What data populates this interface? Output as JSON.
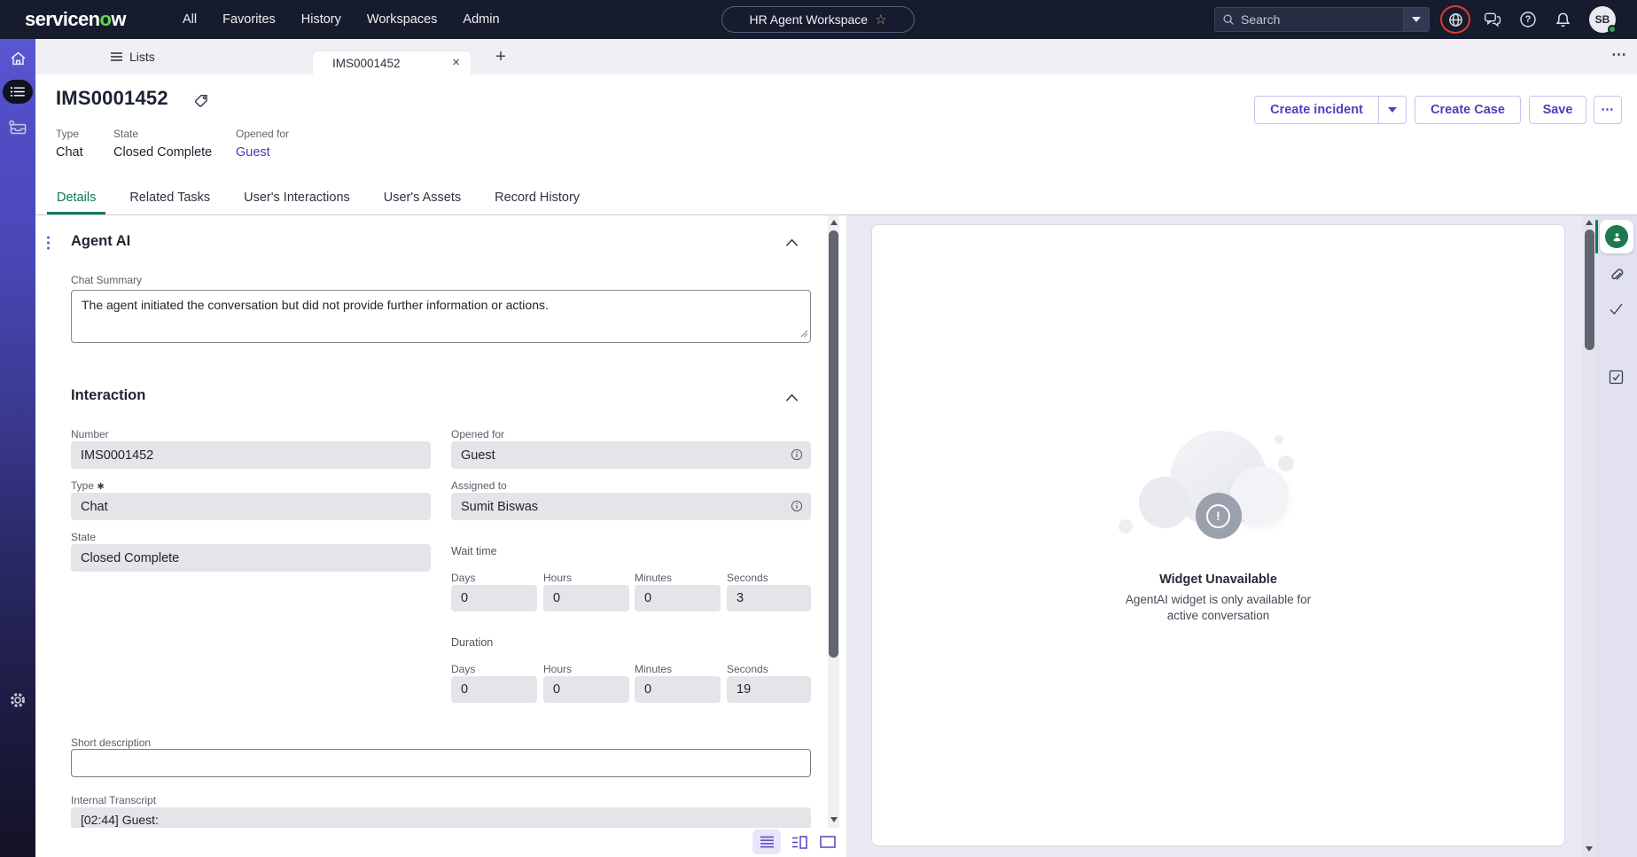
{
  "header": {
    "logo": {
      "part1": "servicen",
      "accent": "o",
      "part2": "w"
    },
    "nav": [
      "All",
      "Favorites",
      "History",
      "Workspaces",
      "Admin"
    ],
    "workspace_pill": "HR Agent Workspace",
    "search": {
      "placeholder": "Search"
    },
    "avatar": {
      "initials": "SB"
    }
  },
  "tabstrip": {
    "lists": "Lists",
    "active_tab": "IMS0001452"
  },
  "record": {
    "title": "IMS0001452",
    "meta": {
      "type_label": "Type",
      "type_value": "Chat",
      "state_label": "State",
      "state_value": "Closed Complete",
      "opened_for_label": "Opened for",
      "opened_for_value": "Guest"
    },
    "actions": {
      "create_incident": "Create incident",
      "create_case": "Create Case",
      "save": "Save"
    }
  },
  "detail_tabs": [
    "Details",
    "Related Tasks",
    "User's Interactions",
    "User's Assets",
    "Record History"
  ],
  "form": {
    "agent_ai_title": "Agent AI",
    "chat_summary": {
      "label": "Chat Summary",
      "value": "The agent initiated the conversation but did not provide further information or actions."
    },
    "interaction_title": "Interaction",
    "number": {
      "label": "Number",
      "value": "IMS0001452"
    },
    "opened_for": {
      "label": "Opened for",
      "value": "Guest"
    },
    "type": {
      "label": "Type",
      "value": "Chat"
    },
    "assigned_to": {
      "label": "Assigned to",
      "value": "Sumit Biswas"
    },
    "state": {
      "label": "State",
      "value": "Closed Complete"
    },
    "wait_time": {
      "label": "Wait time",
      "units": [
        {
          "label": "Days",
          "value": "0"
        },
        {
          "label": "Hours",
          "value": "0"
        },
        {
          "label": "Minutes",
          "value": "0"
        },
        {
          "label": "Seconds",
          "value": "3"
        }
      ]
    },
    "duration": {
      "label": "Duration",
      "units": [
        {
          "label": "Days",
          "value": "0"
        },
        {
          "label": "Hours",
          "value": "0"
        },
        {
          "label": "Minutes",
          "value": "0"
        },
        {
          "label": "Seconds",
          "value": "19"
        }
      ]
    },
    "short_description": {
      "label": "Short description"
    },
    "internal_transcript": {
      "label": "Internal Transcript",
      "value": "[02:44] Guest:"
    }
  },
  "widget_panel": {
    "title": "Widget Unavailable",
    "message": "AgentAI widget is only available for active conversation"
  },
  "glyphs": {
    "star": "☆",
    "close": "×",
    "plus": "+",
    "ellipsis": "⋯",
    "required": "✱",
    "exclaim": "!",
    "question": "?"
  },
  "colors": {
    "header_bg": "#161b2d",
    "accent_indigo": "#4a42bc",
    "accent_green": "#0b7a5e",
    "logo_green": "#62d84e",
    "content_bg": "#e9e9f4",
    "readonly_bg": "#e4e4e9",
    "alert_red": "#de3b30"
  }
}
